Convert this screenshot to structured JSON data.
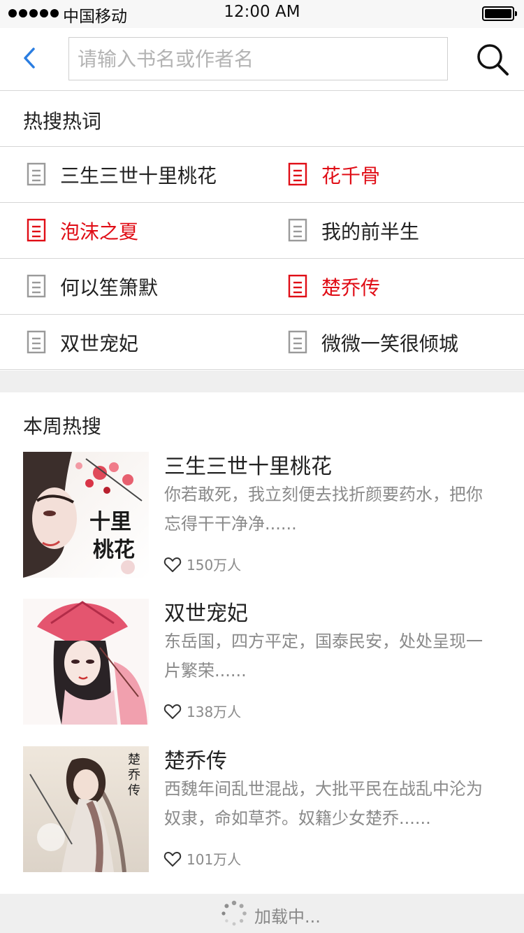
{
  "status_bar": {
    "carrier": "中国移动",
    "time": "12:00 AM"
  },
  "header": {
    "search_placeholder": "请输入书名或作者名"
  },
  "hot_words": {
    "title": "热搜热词",
    "items": [
      {
        "label": "三生三世十里桃花",
        "hot": false
      },
      {
        "label": "花千骨",
        "hot": true
      },
      {
        "label": "泡沫之夏",
        "hot": true
      },
      {
        "label": "我的前半生",
        "hot": false
      },
      {
        "label": "何以笙箫默",
        "hot": false
      },
      {
        "label": "楚乔传",
        "hot": true
      },
      {
        "label": "双世宠妃",
        "hot": false
      },
      {
        "label": "微微一笑很倾城",
        "hot": false
      }
    ]
  },
  "weekly": {
    "title": "本周热搜",
    "books": [
      {
        "title": "三生三世十里桃花",
        "desc": "你若敢死，我立刻便去找折颜要药水，把你忘得干干净净......",
        "likes": "150万人"
      },
      {
        "title": "双世宠妃",
        "desc": "东岳国，四方平定，国泰民安，处处呈现一片繁荣......",
        "likes": "138万人"
      },
      {
        "title": "楚乔传",
        "desc": "西魏年间乱世混战，大批平民在战乱中沦为奴隶，命如草芥。奴籍少女楚乔......",
        "likes": "101万人"
      }
    ]
  },
  "footer": {
    "loading_text": "加载中..."
  },
  "colors": {
    "hot_red": "#e00d16",
    "accent_blue": "#2a7de1",
    "muted_gray": "#8a8a8a"
  }
}
